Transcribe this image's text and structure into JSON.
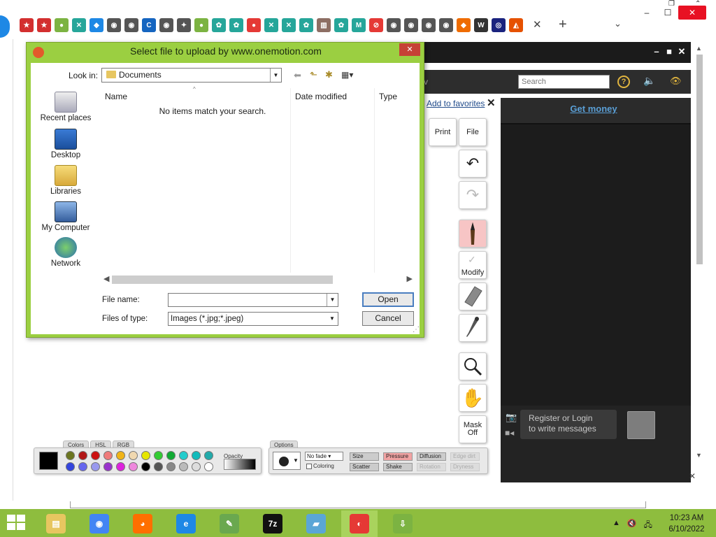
{
  "browser": {
    "tab_close": "✕",
    "new_tab": "+",
    "tab_chevron": "⌄",
    "tab_favicons": [
      {
        "icon": "bookmark-icon",
        "color": "#d32f2f",
        "glyph": "★"
      },
      {
        "icon": "bookmark-icon",
        "color": "#d32f2f",
        "glyph": "★"
      },
      {
        "icon": "leaf-icon",
        "color": "#7cb342",
        "glyph": "●"
      },
      {
        "icon": "x-icon",
        "color": "#26a69a",
        "glyph": "✕"
      },
      {
        "icon": "diamond-icon",
        "color": "#1e88e5",
        "glyph": "◆"
      },
      {
        "icon": "chrome-icon",
        "color": "#555555",
        "glyph": "◉"
      },
      {
        "icon": "globe-icon",
        "color": "#555555",
        "glyph": "◉"
      },
      {
        "icon": "c-icon",
        "color": "#1565c0",
        "glyph": "C"
      },
      {
        "icon": "chrome-icon",
        "color": "#555555",
        "glyph": "◉"
      },
      {
        "icon": "puzzle-icon",
        "color": "#555555",
        "glyph": "✦"
      },
      {
        "icon": "leaf-icon",
        "color": "#7cb342",
        "glyph": "●"
      },
      {
        "icon": "gear-icon",
        "color": "#26a69a",
        "glyph": "✿"
      },
      {
        "icon": "gear-icon",
        "color": "#26a69a",
        "glyph": "✿"
      },
      {
        "icon": "onemotion-icon",
        "color": "#e53935",
        "glyph": "●"
      },
      {
        "icon": "x-icon",
        "color": "#26a69a",
        "glyph": "✕"
      },
      {
        "icon": "x-icon",
        "color": "#26a69a",
        "glyph": "✕"
      },
      {
        "icon": "gear-icon",
        "color": "#26a69a",
        "glyph": "✿"
      },
      {
        "icon": "building-icon",
        "color": "#8d6e63",
        "glyph": "▥"
      },
      {
        "icon": "gear-icon",
        "color": "#26a69a",
        "glyph": "✿"
      },
      {
        "icon": "m-icon",
        "color": "#26a69a",
        "glyph": "M"
      },
      {
        "icon": "nosign-icon",
        "color": "#e53935",
        "glyph": "⊘"
      },
      {
        "icon": "globe-icon",
        "color": "#555555",
        "glyph": "◉"
      },
      {
        "icon": "globe-icon",
        "color": "#555555",
        "glyph": "◉"
      },
      {
        "icon": "globe-icon",
        "color": "#555555",
        "glyph": "◉"
      },
      {
        "icon": "globe-icon",
        "color": "#555555",
        "glyph": "◉"
      },
      {
        "icon": "diamond-icon",
        "color": "#ef6c00",
        "glyph": "◆"
      },
      {
        "icon": "wikipedia-icon",
        "color": "#333333",
        "glyph": "W"
      },
      {
        "icon": "target-icon",
        "color": "#1a237e",
        "glyph": "◎"
      },
      {
        "icon": "fox-icon",
        "color": "#e65100",
        "glyph": "◭"
      }
    ],
    "window_controls": {
      "minimize": "–",
      "maximize": "☐",
      "close": "✕"
    },
    "top_extra_1": "❐",
    "top_extra_2": "⌃"
  },
  "app": {
    "search_placeholder": "Search",
    "help_glyph": "?",
    "sound_glyph": "🔈",
    "eye_glyph": "👁",
    "partial_text": "v",
    "add_to_favorites": "Add to favorites",
    "favorites_close": "✕",
    "get_money": "Get money",
    "register_line1": "Register or Login",
    "register_line2": "to write messages",
    "app_minimize": "–",
    "app_maximize": "■",
    "app_close": "✕",
    "chat_close": "✕",
    "tools": {
      "print": "Print",
      "file": "File",
      "undo": "↶",
      "redo": "↷",
      "modify": "Modify",
      "mask_line1": "Mask",
      "mask_line2": "Off"
    },
    "palette": {
      "tabs": [
        "Colors",
        "HSL",
        "RGB"
      ],
      "current_color": "#000000",
      "swatches": [
        "#6b7520",
        "#b11616",
        "#cc1111",
        "#ef7b7b",
        "#f0b418",
        "#f0d8b0",
        "#e6e600",
        "#33cc33",
        "#11aa33",
        "#22cccc",
        "#11bbbb",
        "#22aaaa",
        "#3344dd",
        "#6666ee",
        "#9999ee",
        "#9933cc",
        "#dd22dd",
        "#ee88dd",
        "#000000",
        "#555555",
        "#888888",
        "#bbbbbb",
        "#dddddd",
        "#ffffff"
      ],
      "opacity_label": "Opacity"
    },
    "options": {
      "tab": "Options",
      "fade": "No fade",
      "coloring": "Coloring",
      "size": "Size",
      "pressure": "Pressure",
      "diffusion": "Diffusion",
      "edge_dirt": "Edge dirt",
      "scatter": "Scatter",
      "shake": "Shake",
      "rotation": "Rotation",
      "dryness": "Dryness"
    }
  },
  "dialog": {
    "title": "Select file to upload by www.onemotion.com",
    "close": "✕",
    "look_in_label": "Look in:",
    "look_in_value": "Documents",
    "places": [
      "Recent places",
      "Desktop",
      "Libraries",
      "My Computer",
      "Network"
    ],
    "columns": [
      "Name",
      "Date modified",
      "Type"
    ],
    "empty_message": "No items match your search.",
    "file_name_label": "File name:",
    "file_name_value": "",
    "files_of_type_label": "Files of type:",
    "files_of_type_value": "Images (*.jpg;*.jpeg)",
    "open_button": "Open",
    "cancel_button": "Cancel"
  },
  "taskbar": {
    "apps": [
      {
        "name": "file-explorer",
        "color": "#e7c660",
        "glyph": "▤"
      },
      {
        "name": "chrome",
        "color": "#4285f4",
        "glyph": "◉"
      },
      {
        "name": "firefox",
        "color": "#ff6f00",
        "glyph": "◕"
      },
      {
        "name": "internet-explorer",
        "color": "#1e88e5",
        "glyph": "e"
      },
      {
        "name": "notepad-plus",
        "color": "#6aa84f",
        "glyph": "✎"
      },
      {
        "name": "7zip",
        "color": "#111111",
        "glyph": "7z"
      },
      {
        "name": "notebook",
        "color": "#5aa6d6",
        "glyph": "▰"
      },
      {
        "name": "onemotion",
        "color": "#e53935",
        "glyph": "◐"
      },
      {
        "name": "downloader",
        "color": "#7cb342",
        "glyph": "⇩"
      }
    ],
    "time": "10:23 AM",
    "date": "6/10/2022",
    "tray_up": "▲",
    "tray_sound": "🔇",
    "tray_network": "🖧"
  }
}
